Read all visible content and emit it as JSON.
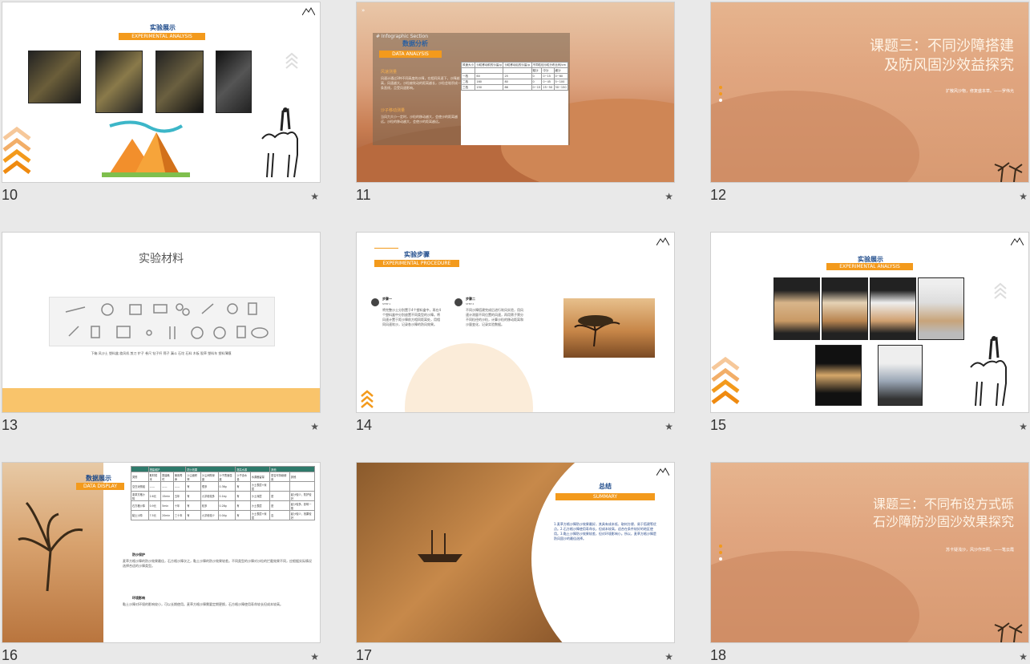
{
  "slides": [
    {
      "number": "10",
      "title": "实验展示",
      "subtitle": "EXPERIMENTAL ANALYSIS"
    },
    {
      "number": "11",
      "watermark": "# Infographic Section",
      "title": "数据分析",
      "subtitle": "DATA ANALYSIS",
      "point1_title": "风速测量",
      "point1_text": "风速计通过3种不同高度的沙障，在相同风速下，沙障越高，风速越大。沙粒被吹动的距离越长，沙粒会堆积成一条直线，且受风速影响。",
      "point2_title": "沙子移动测量",
      "point2_text": "当风力大小一定时，沙粒的移动越大，会使沙的距离越远。沙粒的移动越大，会使沙的距离越远。",
      "table_headers": [
        "风速大小",
        "沙粒移动前的沙量/g",
        "沙粒移动后的沙量/g",
        "不同粒径沙粒分布比例/cm"
      ],
      "table_subheaders": [
        "粗沙",
        "中沙",
        "细沙"
      ],
      "table_rows": [
        [
          "一档",
          "60",
          "25",
          "0",
          "0~15",
          "0~60"
        ],
        [
          "二档",
          "160",
          "80",
          "0",
          "0~45",
          "5~100"
        ],
        [
          "三档",
          "150",
          "86",
          "0~15",
          "25~50",
          "30~150"
        ]
      ]
    },
    {
      "number": "12",
      "title_line1": "课题三：不同沙障搭建",
      "title_line2": "及防风固沙效益探究",
      "caption": "扩散风沙物，修复盛本草。——罗伟允"
    },
    {
      "number": "13",
      "title": "实验材料",
      "items": "下箱 风沙土 塑料盒 旋风机 剪刀 铲子 卷尺 钻子杆 筛子 漏斗 石坨 石料 木板 股草 塑料车 塑料薄膜"
    },
    {
      "number": "14",
      "title": "实验步骤",
      "subtitle": "EXPERIMENTAL PROCEDURE",
      "step1_title": "步骤一",
      "step1_sub": "STEP 1",
      "step1_text": "将完整沙土分别置于4个塑料盒中，再在4个塑料盒中分别放置不同类型的沙障。将风速计置于距沙障前方相同距离处，用相同风速吹沙，记录各沙障的防风效果。",
      "step2_title": "步骤二",
      "step2_sub": "STEP 2",
      "step2_text": "不同沙障搭建完成后进行吹风实验，用风速计测量不同位置的风速，再用筛子筛分不同粒径的沙粒，计算沙粒的移动距离和沙量变化，记录实验数据。"
    },
    {
      "number": "15",
      "title": "实验展示",
      "subtitle": "EXPERIMENTAL ANALYSIS"
    },
    {
      "number": "16",
      "title": "数据展示",
      "subtitle": "DATA DISPLAY",
      "header_groups": [
        "搭建维护",
        "防沙效果",
        "提高水源",
        "其他"
      ],
      "header_cols": [
        "类别",
        "取材成本",
        "搭建耗时",
        "使用寿命",
        "沙尘面积率",
        "沙尘间隙深度",
        "沙子表面湿度",
        "沙子含水量",
        "水源截留量",
        "是否可持续使用",
        "其他"
      ],
      "rows": [
        [
          "空白对照组",
          "——",
          "——",
          "——",
          "有",
          "很多",
          "0.36g",
          "有",
          "沙土表层+深层",
          "",
          ""
        ],
        [
          "麦草方格沙障",
          "2.6元",
          "15min",
          "五年",
          "有",
          "九字段较多",
          "0.1kg",
          "有",
          "沙土深层",
          "是",
          "起沙较少，防护较好"
        ],
        [
          "石方格沙障",
          "0.9元",
          "5min",
          "十年",
          "有",
          "较多",
          "0.28g",
          "有",
          "沙土表层",
          "是",
          "起沙较多，影响一般"
        ],
        [
          "黏土沙障",
          "7.5元",
          "20min",
          "三十年",
          "有",
          "九字段较少",
          "0.04g",
          "有",
          "沙土表层+深层",
          "否",
          "起沙较少，效果较好"
        ]
      ],
      "section1": "防沙保护",
      "section1_text": "麦草方格沙障的防沙效果最佳，石方格沙障次之，黏土沙障的防沙效果较差。不同类型的沙障对沙粒的拦截效果不同，应根据实际情况选择合适的沙障类型。",
      "section2": "环境影响",
      "section2_text": "黏土沙障对环境的影响较小，可以长期使用。麦草方格沙障需要定期更换，石方格沙障使用寿命较长但成本较高。"
    },
    {
      "number": "17",
      "title": "总结",
      "subtitle": "SUMMARY",
      "summary_text": "1.麦草方格沙障防沙效果最好，其具有成本低、取材方便、易于搭建等优点。2.石方格沙障使用寿命长，但成本较高，适合在条件较好的地区使用。3.黏土沙障防沙效果较差，但对环境影响小。所以，麦草方格沙障是防风固沙的最佳选择。"
    },
    {
      "number": "18",
      "title_line1": "课题三：不同布设方式砾",
      "title_line2": "石沙障防沙固沙效果探究",
      "caption": "苏卡疑浅沙，风沙作日照。——笔云霞"
    }
  ],
  "colors": {
    "orange": "#f39a1c",
    "blue": "#1d4a8a",
    "teal": "#2f7a6b"
  }
}
